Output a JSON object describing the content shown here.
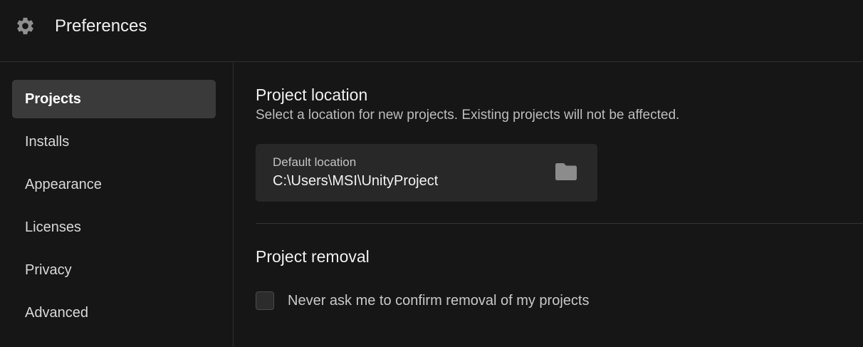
{
  "window": {
    "title": "Preferences",
    "title_icon": "gear-icon"
  },
  "sidebar": {
    "items": [
      {
        "label": "Projects",
        "active": true
      },
      {
        "label": "Installs",
        "active": false
      },
      {
        "label": "Appearance",
        "active": false
      },
      {
        "label": "Licenses",
        "active": false
      },
      {
        "label": "Privacy",
        "active": false
      },
      {
        "label": "Advanced",
        "active": false
      }
    ]
  },
  "main": {
    "location": {
      "heading": "Project location",
      "description": "Select a location for new projects. Existing projects will not be affected.",
      "field_label": "Default location",
      "field_value": "C:\\Users\\MSI\\UnityProject",
      "browse_icon": "folder-icon"
    },
    "removal": {
      "heading": "Project removal",
      "checkbox_label": "Never ask me to confirm removal of my projects",
      "checked": false
    }
  },
  "colors": {
    "background": "#161616",
    "active_nav": "#3a3a3a",
    "field_background": "#282828"
  }
}
